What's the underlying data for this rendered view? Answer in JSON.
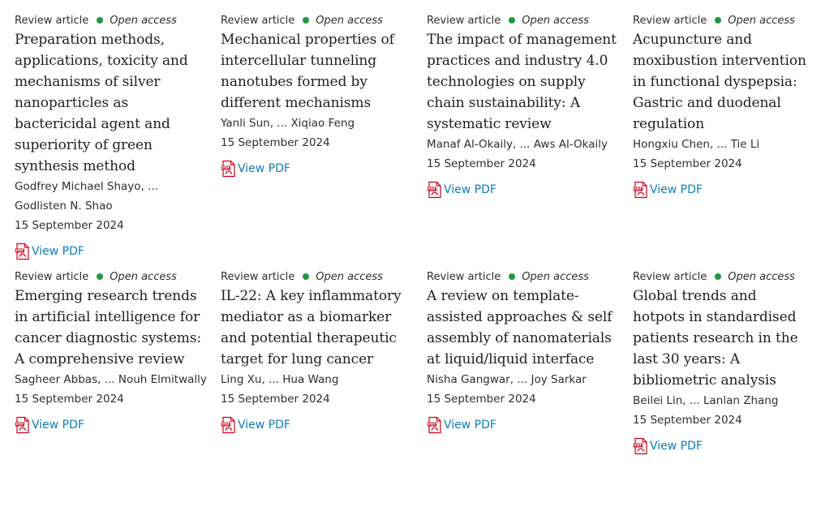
{
  "pdf_label": "View PDF",
  "colors": {
    "open_access_dot": "#1d9a3c",
    "link": "#0c7dbb",
    "pdf_icon": "#d0021b"
  },
  "articles": [
    {
      "type": "Review article",
      "access": "Open access",
      "title": "Preparation methods, applications, toxicity and mechanisms of silver nanoparticles as bactericidal agent and superiority of green synthesis method",
      "authors": "Godfrey Michael Shayo, ... Godlisten N. Shao",
      "date": "15 September 2024"
    },
    {
      "type": "Review article",
      "access": "Open access",
      "title": "Mechanical properties of intercellular tunneling nanotubes formed by different mechanisms",
      "authors": "Yanli Sun, ... Xiqiao Feng",
      "date": "15 September 2024"
    },
    {
      "type": "Review article",
      "access": "Open access",
      "title": "The impact of management practices and industry 4.0 technologies on supply chain sustainability: A systematic review",
      "authors": "Manaf Al-Okaily, ... Aws Al-Okaily",
      "date": "15 September 2024"
    },
    {
      "type": "Review article",
      "access": "Open access",
      "title": "Acupuncture and moxibustion intervention in functional dyspepsia: Gastric and duodenal regulation",
      "authors": "Hongxiu Chen, ... Tie Li",
      "date": "15 September 2024"
    },
    {
      "type": "Review article",
      "access": "Open access",
      "title": "Emerging research trends in artificial intelligence for cancer diagnostic systems: A comprehensive review",
      "authors": "Sagheer Abbas, ... Nouh Elmitwally",
      "date": "15 September 2024"
    },
    {
      "type": "Review article",
      "access": "Open access",
      "title": "IL-22: A key inflammatory mediator as a biomarker and potential therapeutic target for lung cancer",
      "authors": "Ling Xu, ... Hua Wang",
      "date": "15 September 2024"
    },
    {
      "type": "Review article",
      "access": "Open access",
      "title": "A review on template-assisted approaches & self assembly of nanomaterials at liquid/liquid interface",
      "authors": "Nisha Gangwar, ... Joy Sarkar",
      "date": "15 September 2024"
    },
    {
      "type": "Review article",
      "access": "Open access",
      "title": "Global trends and hotpots in standardised patients research in the last 30 years: A bibliometric analysis",
      "authors": "Beilei Lin, ... Lanlan Zhang",
      "date": "15 September 2024"
    }
  ]
}
